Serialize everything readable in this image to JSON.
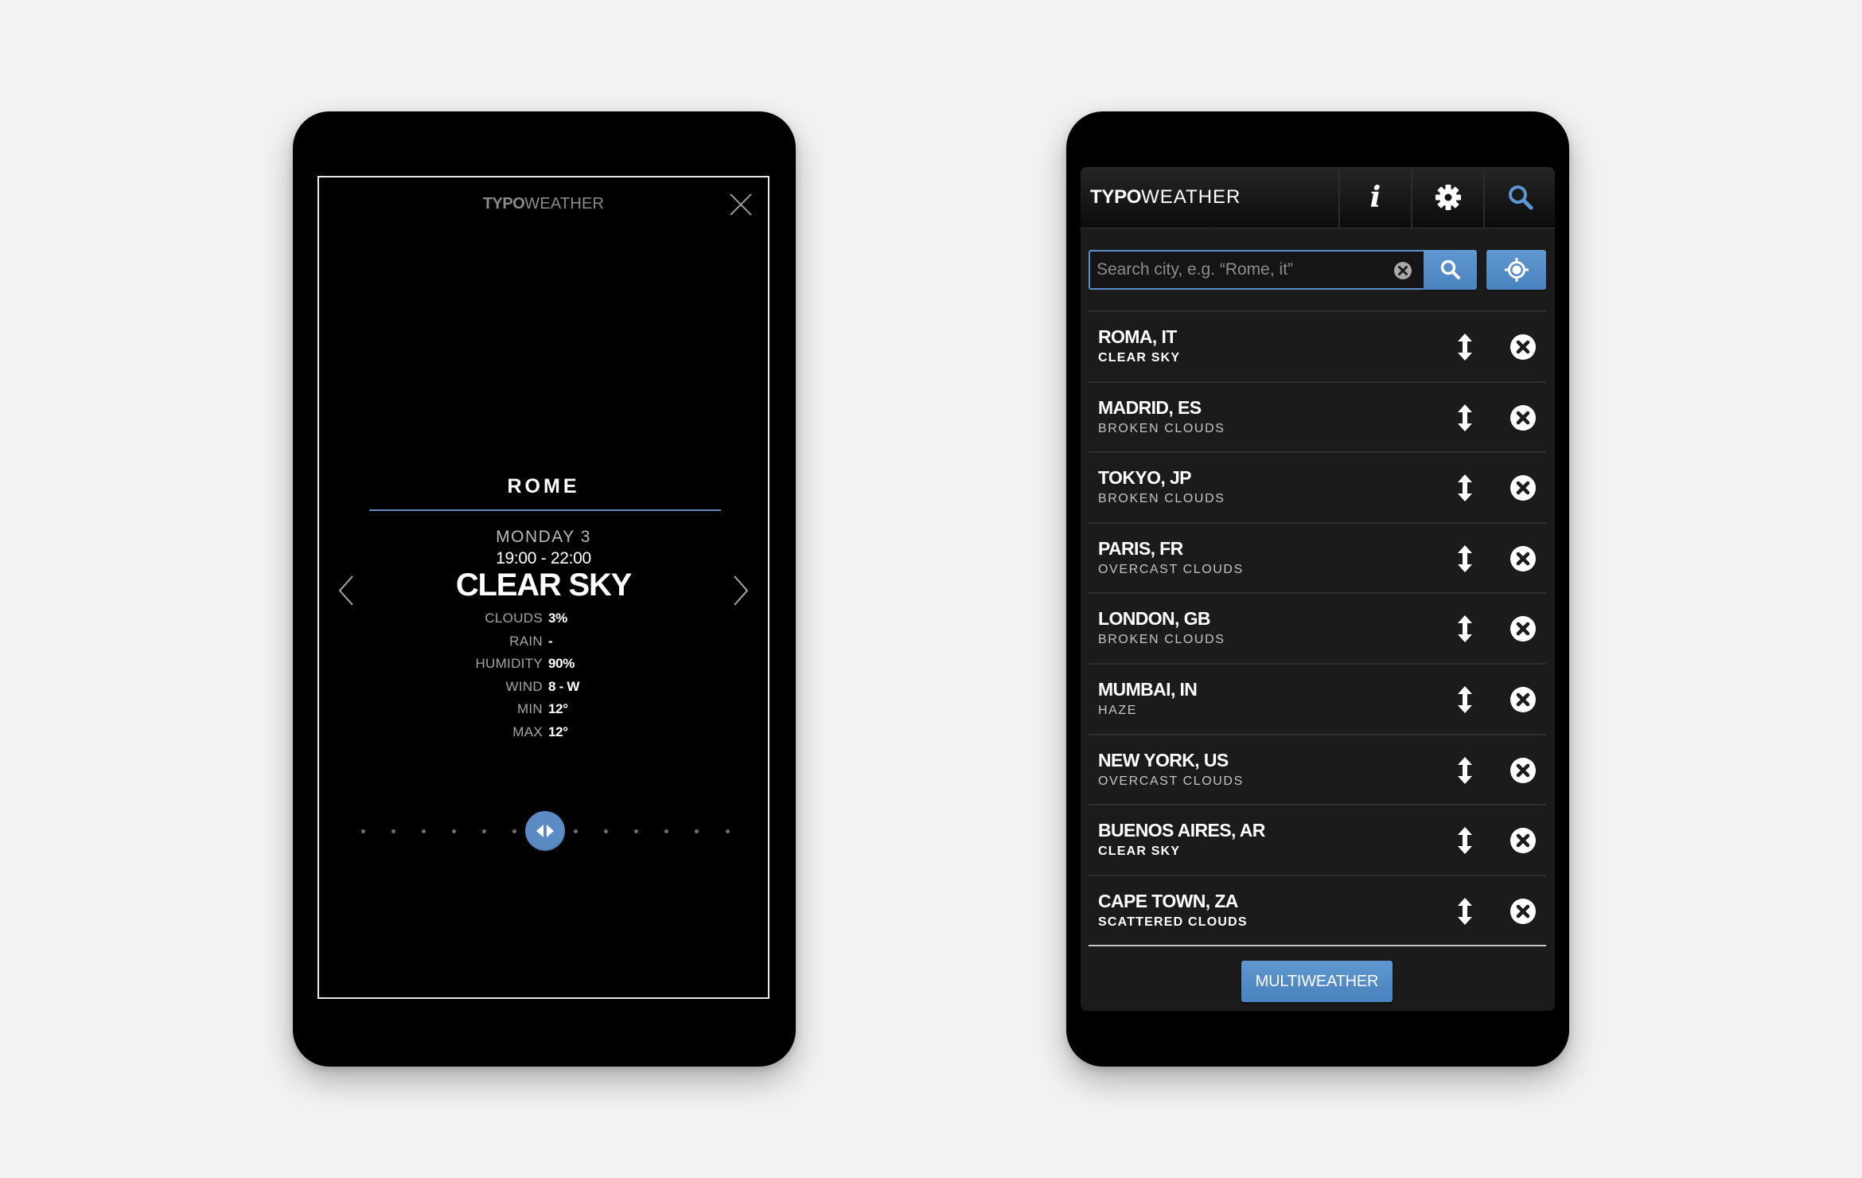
{
  "colors": {
    "accent": "#5b8ac4",
    "phone_body": "#000000",
    "list_background": "#1b1b1b",
    "page_background": "#f2f2f2"
  },
  "detail_screen": {
    "logo_bold": "TYPO",
    "logo_regular": "WEATHER",
    "close_icon": "close-icon",
    "city": "ROME",
    "day": "MONDAY 3",
    "time_range": "19:00 - 22:00",
    "condition": "CLEAR SKY",
    "stats": [
      {
        "label": "CLOUDS",
        "value": "3%"
      },
      {
        "label": "RAIN",
        "value": "-"
      },
      {
        "label": "HUMIDITY",
        "value": "90%"
      },
      {
        "label": "WIND",
        "value": "8 - W"
      },
      {
        "label": "MIN",
        "value": "12°"
      },
      {
        "label": "MAX",
        "value": "12°"
      }
    ],
    "prev_icon": "chevron-left-icon",
    "next_icon": "chevron-right-icon",
    "timeline": {
      "positions": 13,
      "current_index": 6,
      "handle_icon": "left-right-arrows-icon"
    }
  },
  "list_screen": {
    "header": {
      "logo_bold": "TYPO",
      "logo_regular": "WEATHER",
      "buttons": [
        {
          "name": "info",
          "icon": "info-icon",
          "glyph": "i"
        },
        {
          "name": "settings",
          "icon": "gear-icon"
        },
        {
          "name": "search",
          "icon": "search-icon",
          "active": true
        }
      ]
    },
    "search": {
      "value": "",
      "placeholder": "Search city, e.g. “Rome, it”",
      "clear_icon": "clear-icon",
      "submit_icon": "search-icon",
      "locate_icon": "locate-icon"
    },
    "cities": [
      {
        "name": "ROMA, IT",
        "condition": "CLEAR SKY",
        "emphasis": true
      },
      {
        "name": "MADRID, ES",
        "condition": "BROKEN CLOUDS",
        "emphasis": false
      },
      {
        "name": "TOKYO, JP",
        "condition": "BROKEN CLOUDS",
        "emphasis": false
      },
      {
        "name": "PARIS, FR",
        "condition": "OVERCAST CLOUDS",
        "emphasis": false
      },
      {
        "name": "LONDON, GB",
        "condition": "BROKEN CLOUDS",
        "emphasis": false
      },
      {
        "name": "MUMBAI, IN",
        "condition": "HAZE",
        "emphasis": false
      },
      {
        "name": "NEW YORK, US",
        "condition": "OVERCAST CLOUDS",
        "emphasis": false
      },
      {
        "name": "BUENOS AIRES, AR",
        "condition": "CLEAR SKY",
        "emphasis": true
      },
      {
        "name": "CAPE TOWN, ZA",
        "condition": "SCATTERED CLOUDS",
        "emphasis": true
      }
    ],
    "multiweather_label": "MULTIWEATHER"
  }
}
